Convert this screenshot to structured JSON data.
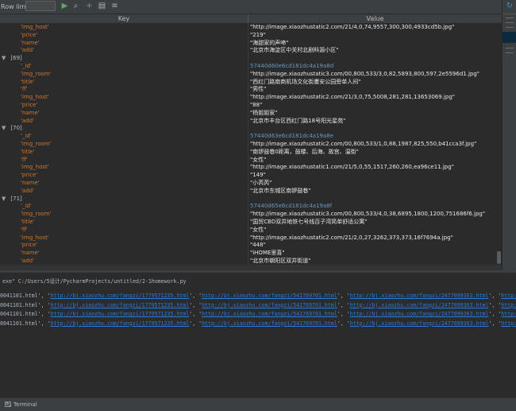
{
  "toolbar": {
    "row_limit_label": "Row limit:",
    "row_limit_value": "",
    "icons": [
      "run-icon",
      "zoom-icon",
      "add-icon",
      "export-icon",
      "filter-icon"
    ]
  },
  "table": {
    "headers": {
      "key": "Key",
      "value": "Value"
    },
    "rows": [
      {
        "key": "'img_host'",
        "value": "\"http://image.xiaozhustatic2.com/21/4,0,74,9557,300,300,4933cd5b.jpg\""
      },
      {
        "key": "'price'",
        "value": "\"219\""
      },
      {
        "key": "'name'",
        "value": "\"海甜家的声啼\""
      },
      {
        "key": "'add'",
        "value": "\"北京市海淀区中关村北剧科源小区\""
      },
      {
        "key": "[69]",
        "value": "",
        "group": true
      },
      {
        "key": "'_id'",
        "value": "57440d60e6cd181dc4a19a8d",
        "id": true
      },
      {
        "key": "'img_room'",
        "value": "\"http://image.xiaozhustatic3.com/00,800,533/3,0,82,5893,800,597,2e5596d1.jpg\""
      },
      {
        "key": "'title'",
        "value": "\"西红门路南商机场文化街畫安公园旁单人间\""
      },
      {
        "key": "'ff'",
        "value": "\"男性\""
      },
      {
        "key": "'img_host'",
        "value": "\"http://image.xiaozhustatic2.com/21/3,0,75,5008,281,281,13653069.jpg\""
      },
      {
        "key": "'price'",
        "value": "\"88\""
      },
      {
        "key": "'name'",
        "value": "\"杨姐姐家\""
      },
      {
        "key": "'add'",
        "value": "\"北京市丰台区西红门路18号阳光星苑\""
      },
      {
        "key": "[70]",
        "value": "",
        "group": true
      },
      {
        "key": "'_id'",
        "value": "57440d63e6cd181dc4a19a8e",
        "id": true
      },
      {
        "key": "'img_room'",
        "value": "\"http://image.xiaozhustatic2.com/00,800,533/1,0,88,1987,825,550,b41cca3f.jpg\""
      },
      {
        "key": "'title'",
        "value": "\"南锣鼓巷0距离，鼓楼、后海、故宫、温街\""
      },
      {
        "key": "'ff'",
        "value": "\"女性\""
      },
      {
        "key": "'img_host'",
        "value": "\"http://image.xiaozhustatic1.com/21/5,0,55,1517,260,260,ea96ce11.jpg\""
      },
      {
        "key": "'price'",
        "value": "\"149\""
      },
      {
        "key": "'name'",
        "value": "\"小芮芮\""
      },
      {
        "key": "'add'",
        "value": "\"北京市东城区南锣鼓巷\""
      },
      {
        "key": "[71]",
        "value": "",
        "group": true
      },
      {
        "key": "'_id'",
        "value": "57440d65e6cd181dc4a19a8f",
        "id": true
      },
      {
        "key": "'img_room'",
        "value": "\"http://image.xiaozhustatic3.com/00,800,533/4,0,38,6895,1800,1200,751686f6.jpg\""
      },
      {
        "key": "'title'",
        "value": "\"国贸CBD双井地铁七号线百子湾简单舒适公寓\""
      },
      {
        "key": "'ff'",
        "value": "\"女性\""
      },
      {
        "key": "'img_host'",
        "value": "\"http://image.xiaozhustatic2.com/21/2,0,27,3262,373,373,16f7694a.jpg\""
      },
      {
        "key": "'price'",
        "value": "\"448\""
      },
      {
        "key": "'name'",
        "value": "\"iHOME里喜\""
      },
      {
        "key": "'add'",
        "value": "\"北京市朝阳区双井街道\""
      }
    ]
  },
  "console": {
    "command": "exe\" C:/Users/5设计/PycharmProjects/untitled/2-1homework.py",
    "lines": [
      {
        "prefix": "0041101.html'",
        "links": [
          "http://bj.xiaozhu.com/fangzi/1779571235.html",
          "http://bj.xiaozhu.com/fangzi/541769701.html",
          "http://bj.xiaozhu.com/fangzi/2477099363.html",
          "http://bj.xiaozhu.com/fangzi/"
        ]
      },
      {
        "prefix": "0041101.html'",
        "links": [
          "http://bj.xiaozhu.com/fangzi/1779571235.html",
          "http://bj.xiaozhu.com/fangzi/541769701.html",
          "http://bj.xiaozhu.com/fangzi/2477099363.html",
          "http://bj.xiaozhu.com/fangzi/"
        ]
      },
      {
        "prefix": "0041101.html'",
        "links": [
          "http://bj.xiaozhu.com/fangzi/1779571235.html",
          "http://bj.xiaozhu.com/fangzi/541769701.html",
          "http://bj.xiaozhu.com/fangzi/2477099363.html",
          "http://bj.xiaozhu.com/fangzi/"
        ]
      },
      {
        "prefix": "0041101.html'",
        "links": [
          "http://bj.xiaozhu.com/fangzi/1779571235.html",
          "http://bj.xiaozhu.com/fangzi/541769701.html",
          "http://bj.xiaozhu.com/fangzi/2477099363.html",
          "http://bj.xiaozhu.com/fangzi/"
        ]
      }
    ]
  },
  "statusbar": {
    "terminal_label": "Terminal"
  }
}
